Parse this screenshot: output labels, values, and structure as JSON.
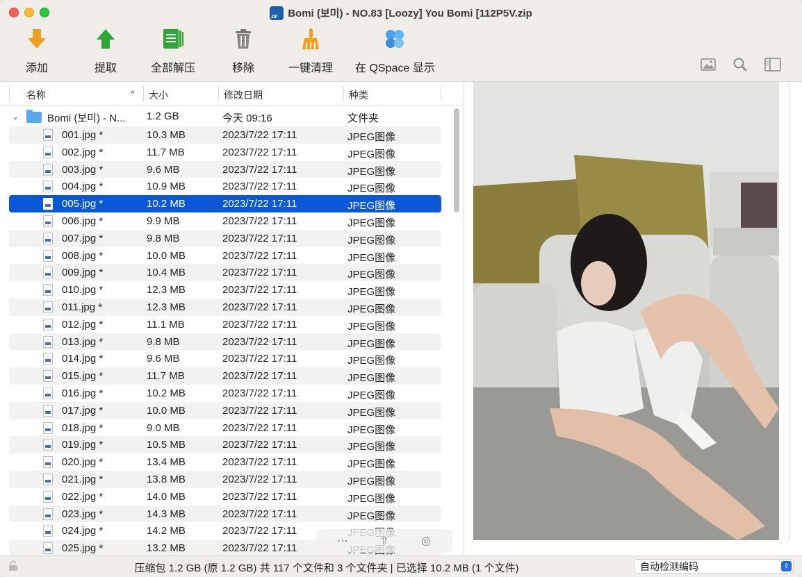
{
  "window": {
    "title": "Bomi (보미) - NO.83 [Loozy] You Bomi [112P5V.zip"
  },
  "toolbar": {
    "add": "添加",
    "extract": "提取",
    "extract_all": "全部解压",
    "remove": "移除",
    "clean": "一键清理",
    "qspace": "在 QSpace 显示"
  },
  "columns": {
    "name": "名称",
    "size": "大小",
    "modified": "修改日期",
    "kind": "种类"
  },
  "folder": {
    "name": "Bomi (보미) - N...",
    "size": "1.2 GB",
    "modified": "今天 09:16",
    "kind": "文件夹"
  },
  "files": [
    {
      "name": "001.jpg *",
      "size": "10.3 MB",
      "modified": "2023/7/22 17:11",
      "kind": "JPEG图像"
    },
    {
      "name": "002.jpg *",
      "size": "11.7 MB",
      "modified": "2023/7/22 17:11",
      "kind": "JPEG图像"
    },
    {
      "name": "003.jpg *",
      "size": "9.6 MB",
      "modified": "2023/7/22 17:11",
      "kind": "JPEG图像"
    },
    {
      "name": "004.jpg *",
      "size": "10.9 MB",
      "modified": "2023/7/22 17:11",
      "kind": "JPEG图像"
    },
    {
      "name": "005.jpg *",
      "size": "10.2 MB",
      "modified": "2023/7/22 17:11",
      "kind": "JPEG图像"
    },
    {
      "name": "006.jpg *",
      "size": "9.9 MB",
      "modified": "2023/7/22 17:11",
      "kind": "JPEG图像"
    },
    {
      "name": "007.jpg *",
      "size": "9.8 MB",
      "modified": "2023/7/22 17:11",
      "kind": "JPEG图像"
    },
    {
      "name": "008.jpg *",
      "size": "10.0 MB",
      "modified": "2023/7/22 17:11",
      "kind": "JPEG图像"
    },
    {
      "name": "009.jpg *",
      "size": "10.4 MB",
      "modified": "2023/7/22 17:11",
      "kind": "JPEG图像"
    },
    {
      "name": "010.jpg *",
      "size": "12.3 MB",
      "modified": "2023/7/22 17:11",
      "kind": "JPEG图像"
    },
    {
      "name": "011.jpg *",
      "size": "12.3 MB",
      "modified": "2023/7/22 17:11",
      "kind": "JPEG图像"
    },
    {
      "name": "012.jpg *",
      "size": "11.1 MB",
      "modified": "2023/7/22 17:11",
      "kind": "JPEG图像"
    },
    {
      "name": "013.jpg *",
      "size": "9.8 MB",
      "modified": "2023/7/22 17:11",
      "kind": "JPEG图像"
    },
    {
      "name": "014.jpg *",
      "size": "9.6 MB",
      "modified": "2023/7/22 17:11",
      "kind": "JPEG图像"
    },
    {
      "name": "015.jpg *",
      "size": "11.7 MB",
      "modified": "2023/7/22 17:11",
      "kind": "JPEG图像"
    },
    {
      "name": "016.jpg *",
      "size": "10.2 MB",
      "modified": "2023/7/22 17:11",
      "kind": "JPEG图像"
    },
    {
      "name": "017.jpg *",
      "size": "10.0 MB",
      "modified": "2023/7/22 17:11",
      "kind": "JPEG图像"
    },
    {
      "name": "018.jpg *",
      "size": "9.0 MB",
      "modified": "2023/7/22 17:11",
      "kind": "JPEG图像"
    },
    {
      "name": "019.jpg *",
      "size": "10.5 MB",
      "modified": "2023/7/22 17:11",
      "kind": "JPEG图像"
    },
    {
      "name": "020.jpg *",
      "size": "13.4 MB",
      "modified": "2023/7/22 17:11",
      "kind": "JPEG图像"
    },
    {
      "name": "021.jpg *",
      "size": "13.8 MB",
      "modified": "2023/7/22 17:11",
      "kind": "JPEG图像"
    },
    {
      "name": "022.jpg *",
      "size": "14.0 MB",
      "modified": "2023/7/22 17:11",
      "kind": "JPEG图像"
    },
    {
      "name": "023.jpg *",
      "size": "14.3 MB",
      "modified": "2023/7/22 17:11",
      "kind": "JPEG图像"
    },
    {
      "name": "024.jpg *",
      "size": "14.2 MB",
      "modified": "2023/7/22 17:11",
      "kind": "JPEG图像"
    },
    {
      "name": "025.jpg *",
      "size": "13.2 MB",
      "modified": "2023/7/22 17:11",
      "kind": "JPEG图像"
    }
  ],
  "selected_index": 4,
  "status": {
    "summary": "压缩包 1.2 GB (原 1.2 GB) 共 117 个文件和 3 个文件夹  |  已选择 10.2 MB (1 个文件)",
    "encoding": "自动检测编码"
  },
  "colors": {
    "selection": "#0a58d6",
    "toolbar_bg": "#f1ede9"
  }
}
